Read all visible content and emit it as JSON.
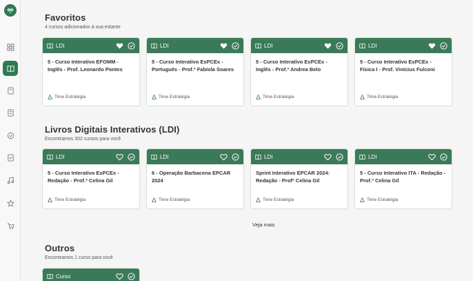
{
  "colors": {
    "brand": "#2f7a53",
    "card_header": "#3b7a58"
  },
  "sidebar": {
    "items": [
      {
        "name": "dashboard-icon"
      },
      {
        "name": "book-icon",
        "active": true
      },
      {
        "name": "notebook-icon"
      },
      {
        "name": "document-icon"
      },
      {
        "name": "check-circle-icon"
      },
      {
        "name": "checklist-icon"
      },
      {
        "name": "music-icon"
      },
      {
        "name": "star-icon"
      },
      {
        "name": "cart-icon"
      }
    ]
  },
  "favorites": {
    "title": "Favoritos",
    "subtitle": "4 cursos adicionados à sua estante",
    "cards": [
      {
        "tag": "LDI",
        "title": "5 - Curso Interativo EFOMM - Inglês - Prof. Leonardo Pontes",
        "author": "Time Estratégia"
      },
      {
        "tag": "LDI",
        "title": "5 - Curso Interativo EsPCEx - Português - Prof.ª Fabíola Soares",
        "author": "Time Estratégia"
      },
      {
        "tag": "LDI",
        "title": "5 - Curso Interativo EsPCEx - Inglês - Prof.ª Andrea Belo",
        "author": "Time Estratégia"
      },
      {
        "tag": "LDI",
        "title": "5 - Curso Interativo EsPCEx - Física I - Prof. Vinícius Fulconi",
        "author": "Time Estratégia"
      }
    ]
  },
  "ldi": {
    "title": "Livros Digitais Interativos (LDI)",
    "subtitle": "Encontramos 302 cursos para você",
    "cards": [
      {
        "tag": "LDI",
        "title": "5 - Curso Interativo EsPCEx - Redação - Prof.ª Celina Gil",
        "author": "Time Estratégia"
      },
      {
        "tag": "LDI",
        "title": "6 - Operação Barbacena EPCAR 2024",
        "author": "Time Estratégia"
      },
      {
        "tag": "LDI",
        "title": "Sprint Interativo EPCAR 2024: Redação - Profª Celina Gil",
        "author": "Time Estratégia"
      },
      {
        "tag": "LDI",
        "title": "5 - Curso Interativo ITA - Redação - Prof.ª Celina Gil",
        "author": "Time Estratégia"
      }
    ],
    "see_more": "Veja mais"
  },
  "others": {
    "title": "Outros",
    "subtitle": "Encontramos 1 curso para você",
    "cards": [
      {
        "tag": "Curso"
      }
    ]
  }
}
